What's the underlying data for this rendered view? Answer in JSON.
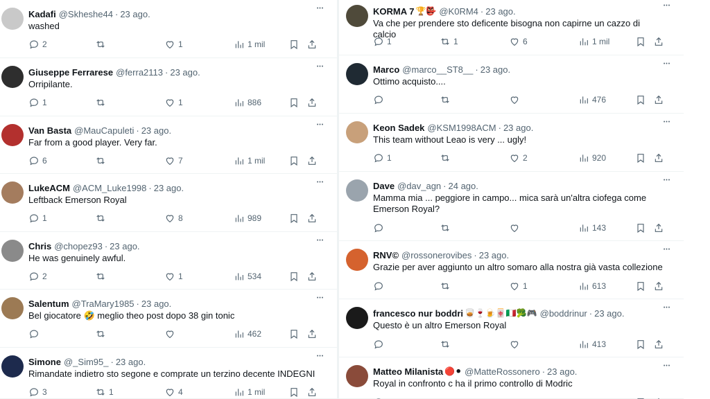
{
  "left_column": [
    {
      "name": "Kadafi",
      "emoji": "",
      "handle": "@Skheshe44",
      "date": "23 ago.",
      "text": "washed",
      "replies": "2",
      "retweets": "",
      "likes": "1",
      "views": "1 mil",
      "avatar_color": "#c9c9c9"
    },
    {
      "name": "Giuseppe Ferrarese",
      "emoji": "",
      "handle": "@ferra2113",
      "date": "23 ago.",
      "text": "Orripilante.",
      "replies": "1",
      "retweets": "",
      "likes": "1",
      "views": "886",
      "avatar_color": "#2e2e2e"
    },
    {
      "name": "Van Basta",
      "emoji": "",
      "handle": "@MauCapuleti",
      "date": "23 ago.",
      "text": "Far from a good player. Very far.",
      "replies": "6",
      "retweets": "",
      "likes": "7",
      "views": "1 mil",
      "avatar_color": "#b3302e"
    },
    {
      "name": "LukeACM",
      "emoji": "",
      "handle": "@ACM_Luke1998",
      "date": "23 ago.",
      "text": "Leftback Emerson Royal",
      "replies": "1",
      "retweets": "",
      "likes": "8",
      "views": "989",
      "avatar_color": "#a47c5e"
    },
    {
      "name": "Chris",
      "emoji": "",
      "handle": "@chopez93",
      "date": "23 ago.",
      "text": "He was genuinely awful.",
      "replies": "2",
      "retweets": "",
      "likes": "1",
      "views": "534",
      "avatar_color": "#8a8a8a"
    },
    {
      "name": "Salentum",
      "emoji": "",
      "handle": "@TraMary1985",
      "date": "23 ago.",
      "text": "Bel giocatore 🤣 meglio theo post dopo 38 gin tonic",
      "replies": "",
      "retweets": "",
      "likes": "",
      "views": "462",
      "avatar_color": "#9c7a54"
    },
    {
      "name": "Simone",
      "emoji": "",
      "handle": "@_Sim95_",
      "date": "23 ago.",
      "text": "Rimandate indietro sto segone e comprate un terzino decente INDEGNI",
      "replies": "3",
      "retweets": "1",
      "likes": "4",
      "views": "1 mil",
      "avatar_color": "#1d2a4d"
    }
  ],
  "right_column": [
    {
      "name": "KORMA 7",
      "emoji": "🏆👺",
      "handle": "@K0RM4",
      "date": "23 ago.",
      "text": "Va che per prendere sto deficente bisogna non capirne un cazzo di calcio",
      "replies": "1",
      "retweets": "1",
      "likes": "6",
      "views": "1 mil",
      "avatar_color": "#4f4a3a"
    },
    {
      "name": "Marco",
      "emoji": "",
      "handle": "@marco__ST8__",
      "date": "23 ago.",
      "text": "Ottimo acquisto....",
      "replies": "",
      "retweets": "",
      "likes": "",
      "views": "476",
      "avatar_color": "#1f2a33"
    },
    {
      "name": "Keon Sadek",
      "emoji": "",
      "handle": "@KSM1998ACM",
      "date": "23 ago.",
      "text": "This team without Leao is very ... ugly!",
      "replies": "1",
      "retweets": "",
      "likes": "2",
      "views": "920",
      "avatar_color": "#c8a07a"
    },
    {
      "name": "Dave",
      "emoji": "",
      "handle": "@dav_agn",
      "date": "24 ago.",
      "text": "Mamma mia ... peggiore in campo... mica sarà un'altra ciofega come Emerson Royal?",
      "replies": "",
      "retweets": "",
      "likes": "",
      "views": "143",
      "avatar_color": "#9aa4ad"
    },
    {
      "name": "RNV©",
      "emoji": "",
      "handle": "@rossonerovibes",
      "date": "23 ago.",
      "text": "Grazie per aver aggiunto un altro somaro alla nostra già vasta collezione",
      "replies": "",
      "retweets": "",
      "likes": "1",
      "views": "613",
      "avatar_color": "#d5622e"
    },
    {
      "name": "francesco nur boddri",
      "emoji": "🥃🍷🍺🀄🇮🇹🥦🎮",
      "handle": "@boddrinur",
      "date": "23 ago.",
      "text": "Questo è un altro Emerson Royal",
      "replies": "",
      "retweets": "",
      "likes": "",
      "views": "413",
      "avatar_color": "#1a1a1a"
    },
    {
      "name": "Matteo Milanista",
      "emoji": "🔴⚫",
      "handle": "@MatteRossonero",
      "date": "23 ago.",
      "text": "Royal in confronto c ha il primo controllo di Modric",
      "replies": "",
      "retweets": "",
      "likes": "",
      "views": "",
      "avatar_color": "#8a4b3a"
    }
  ]
}
